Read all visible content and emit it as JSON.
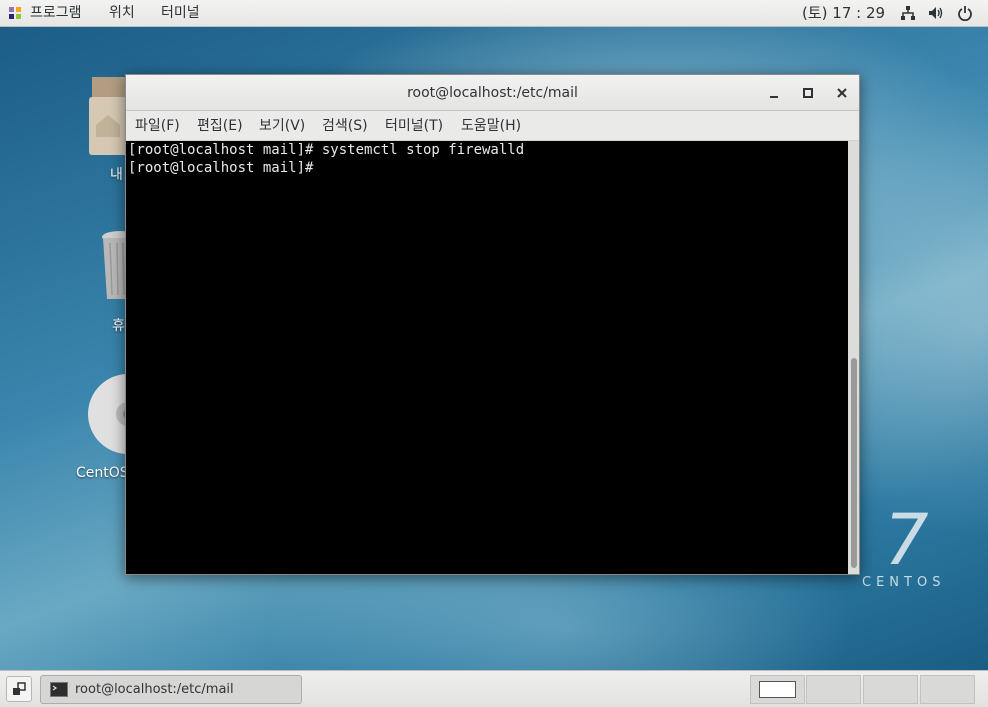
{
  "topbar": {
    "applications_label": "프로그램",
    "places_label": "위치",
    "terminal_label": "터미널",
    "clock": "(토) 17 : 29",
    "icons": [
      "network-icon",
      "volume-icon",
      "power-icon"
    ]
  },
  "desktop": {
    "icons": [
      {
        "label": "내",
        "icon": "home-folder-icon"
      },
      {
        "label": "휴",
        "icon": "trash-icon"
      },
      {
        "label": "CentOS",
        "icon": "disc-icon"
      }
    ],
    "logo": {
      "number": "7",
      "word": "CENTOS"
    }
  },
  "window": {
    "title": "root@localhost:/etc/mail",
    "menu": [
      "파일(F)",
      "편집(E)",
      "보기(V)",
      "검색(S)",
      "터미널(T)",
      "도움말(H)"
    ],
    "terminal_lines": [
      "[root@localhost mail]# systemctl stop firewalld",
      "[root@localhost mail]# "
    ]
  },
  "taskbar": {
    "task_label": "root@localhost:/etc/mail",
    "workspaces": 4,
    "active_workspace": 1
  },
  "colors": {
    "terminal_bg": "#000000",
    "terminal_fg": "#e8e8e8",
    "panel": "#ececeb"
  }
}
